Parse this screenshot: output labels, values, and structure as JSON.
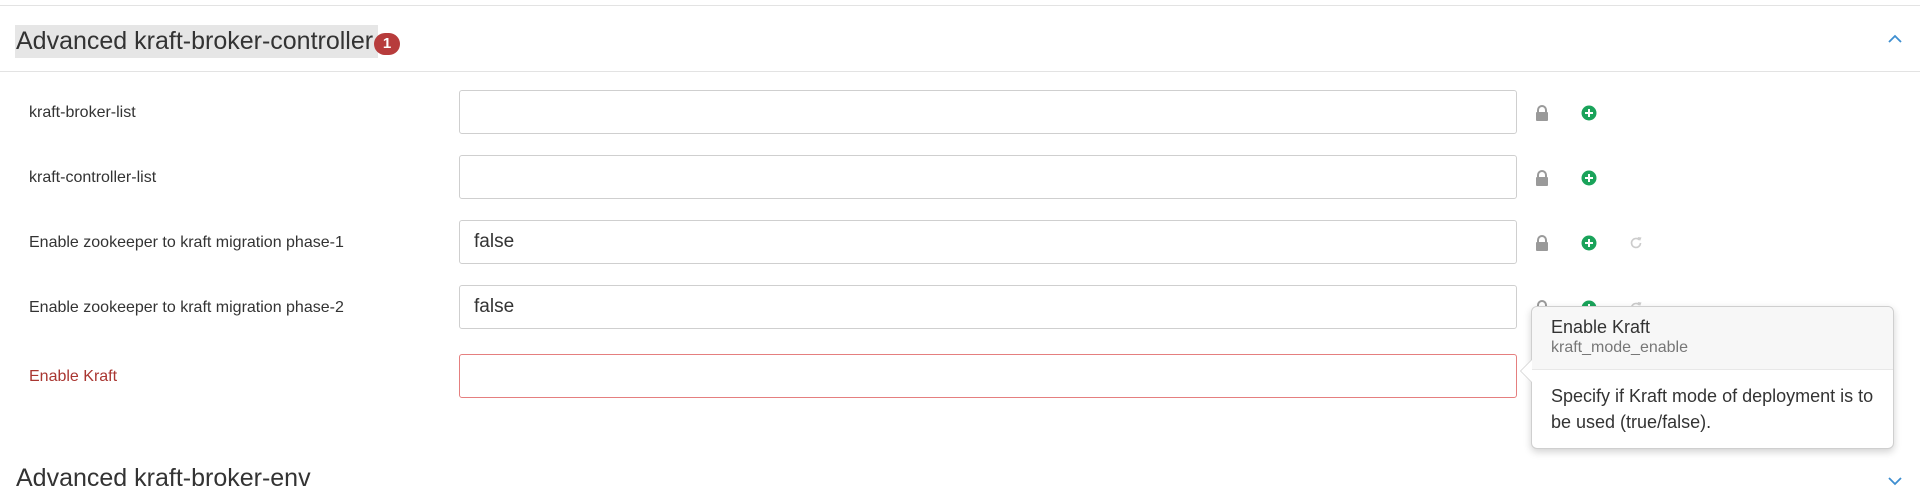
{
  "section": {
    "title": "Advanced kraft-broker-controller",
    "error_count": "1",
    "accent_color": "#3e8ed0",
    "error_color": "#b73c3c"
  },
  "rows": [
    {
      "label": "kraft-broker-list",
      "value": "",
      "has_undo": false,
      "error": false
    },
    {
      "label": "kraft-controller-list",
      "value": "",
      "has_undo": false,
      "error": false
    },
    {
      "label": "Enable zookeeper to kraft migration phase-1",
      "value": "false",
      "has_undo": true,
      "error": false
    },
    {
      "label": "Enable zookeeper to kraft migration phase-2",
      "value": "false",
      "has_undo": true,
      "error": false
    },
    {
      "label": "Enable Kraft",
      "value": "",
      "has_undo": false,
      "error": true
    }
  ],
  "icons": {
    "lock": "lock-icon",
    "add": "plus-circle-icon",
    "undo": "undo-icon",
    "collapse": "chevron-up-icon",
    "expand": "chevron-down-icon"
  },
  "tooltip": {
    "title": "Enable Kraft",
    "property": "kraft_mode_enable",
    "description": "Specify if Kraft mode of deployment is to be used (true/false)."
  },
  "section2": {
    "title": "Advanced kraft-broker-env"
  }
}
